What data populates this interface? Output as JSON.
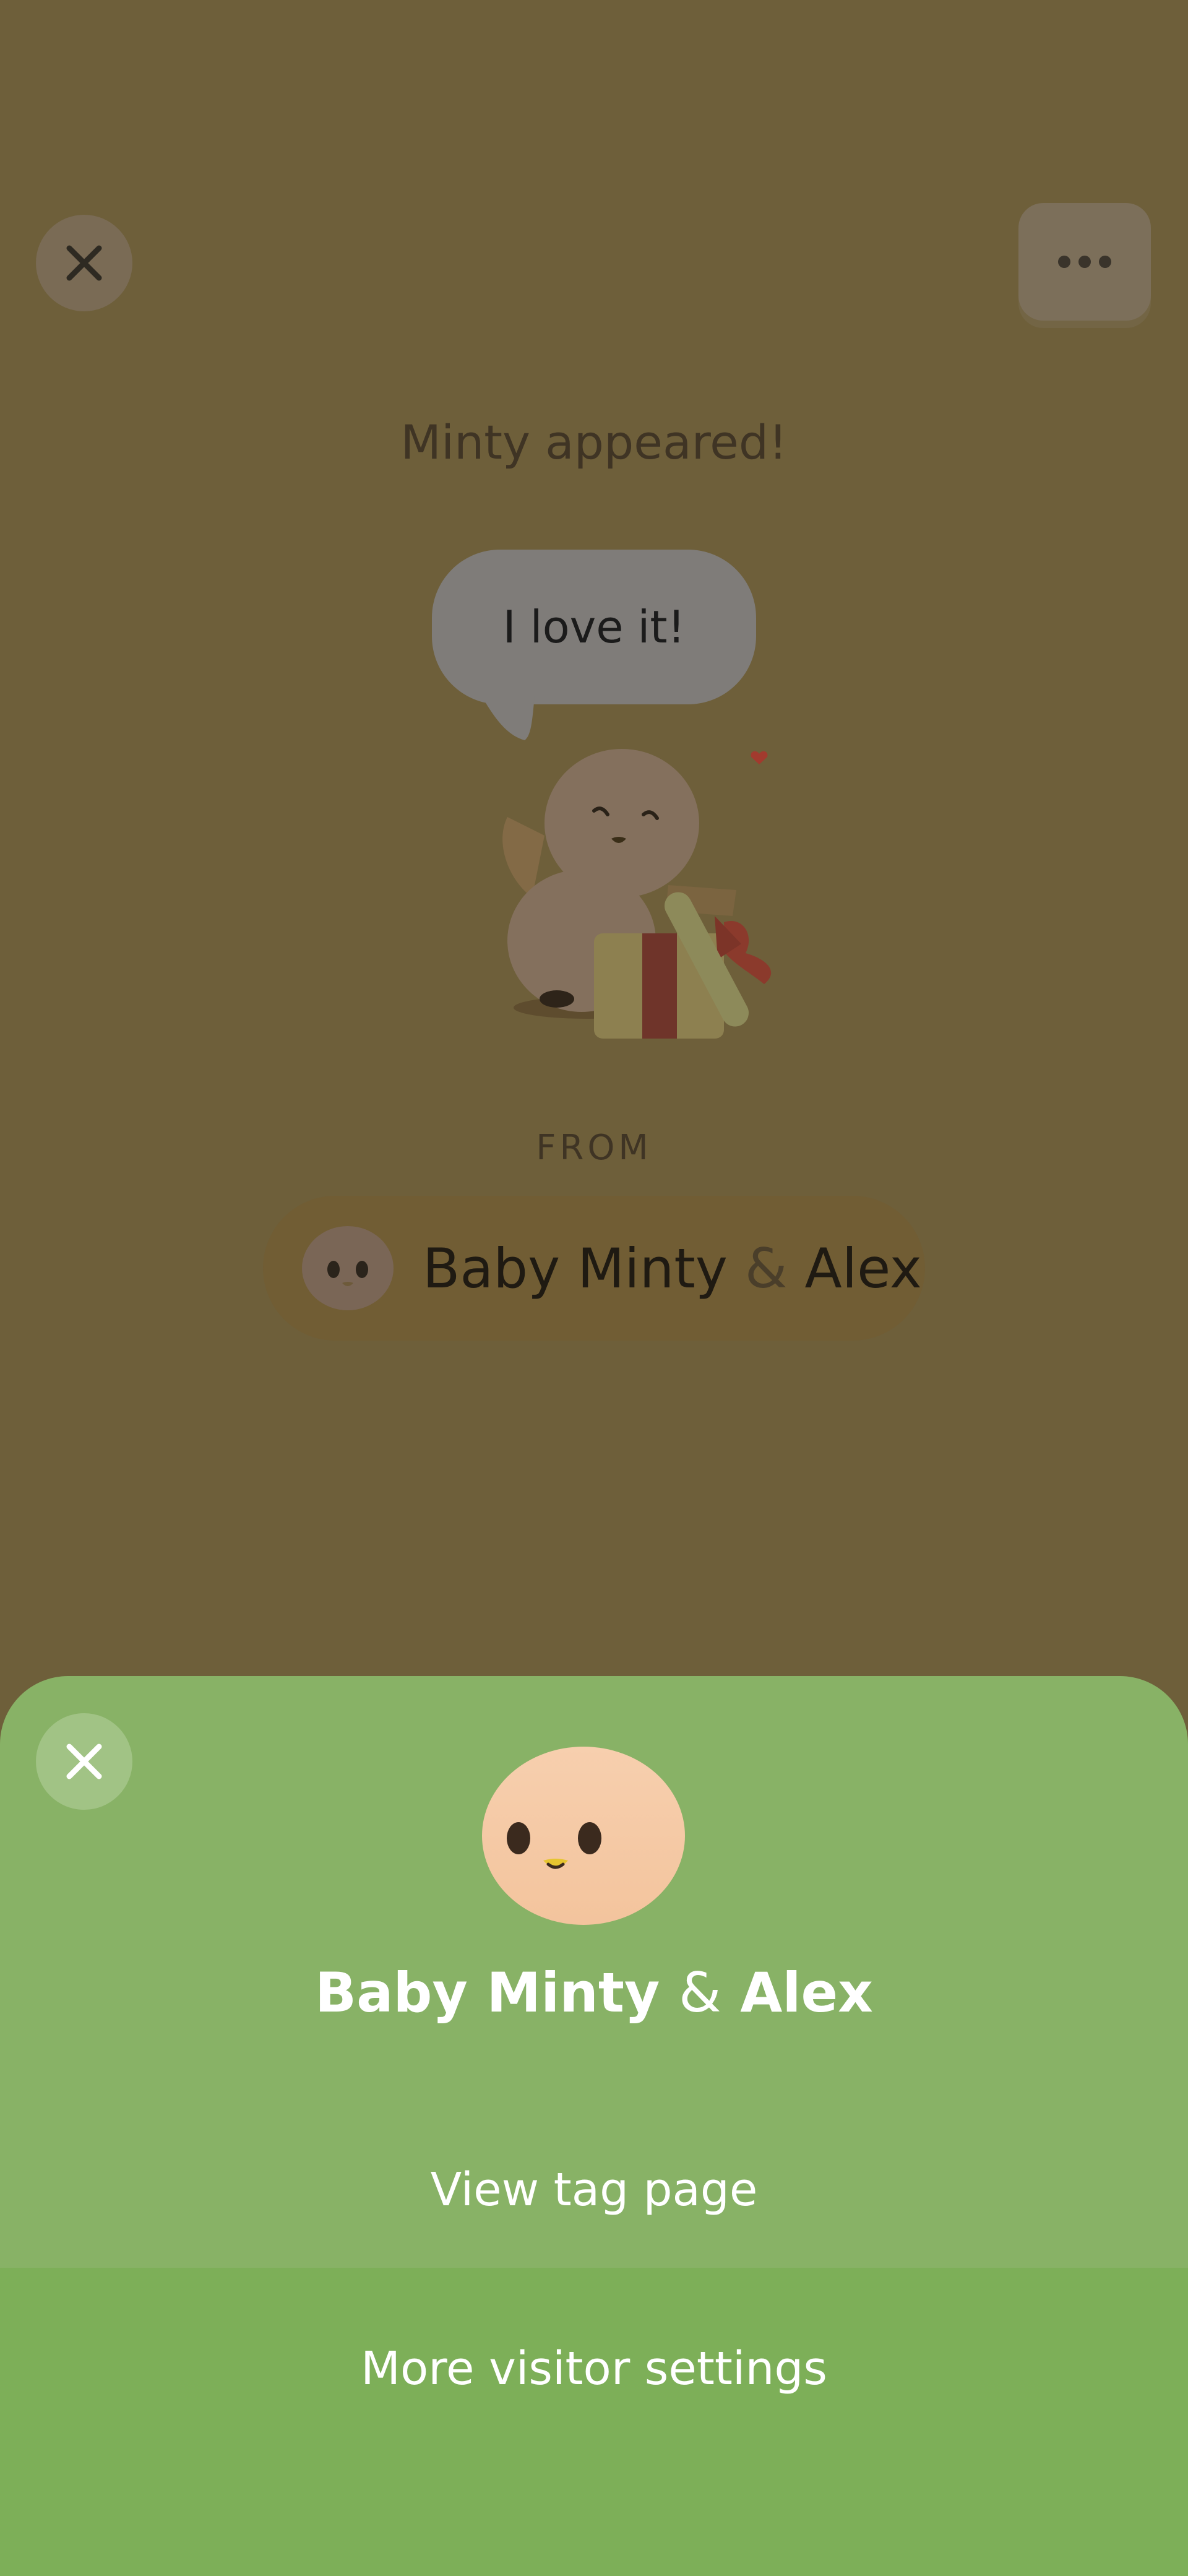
{
  "colors": {
    "backdrop": "#6e5f3a",
    "sheet": "#88b266",
    "sheet_footer": "#7daf58",
    "text_dark": "#3f3424",
    "text_white": "#ffffff"
  },
  "top_bar": {
    "close_icon": "close-icon",
    "more_icon": "more-horizontal-icon"
  },
  "card": {
    "title": "Minty appeared!",
    "speech_bubble": "I love it!",
    "illustration": "bird-with-gift-illustration",
    "from_label": "FROM",
    "from_name_first": "Baby Minty",
    "from_amp": "&",
    "from_name_second": "Alex"
  },
  "sheet": {
    "close_icon": "close-icon",
    "avatar": "chick-face-avatar",
    "name_first": "Baby Minty",
    "name_amp": "&",
    "name_second": "Alex",
    "view_tag_label": "View tag page",
    "more_settings_label": "More visitor settings"
  }
}
